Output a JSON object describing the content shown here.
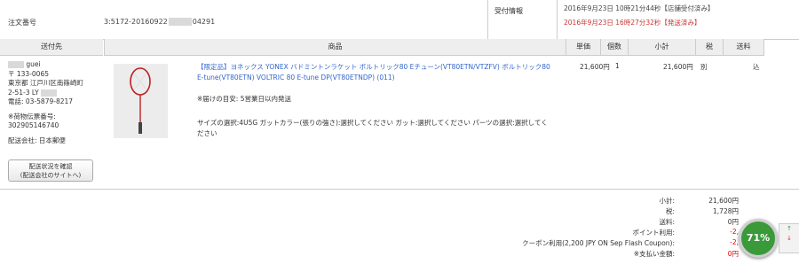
{
  "order": {
    "label": "注文番号",
    "number_prefix": "3:5172-20160922",
    "number_suffix": "04291"
  },
  "info": {
    "label": "受付情報",
    "line1": "2016年9月23日 10時21分44秒【店舗受付済み】",
    "line2": "2016年9月23日 16時27分32秒【発送済み】"
  },
  "headers": {
    "sender": "送付先",
    "product": "商品",
    "unit_price": "単価",
    "qty": "個数",
    "subtotal": "小計",
    "tax": "税",
    "shipping": "送料"
  },
  "sender": {
    "name": "guei",
    "postal": "〒 133-0065",
    "address1": "東京都 江戸川区南篠崎町",
    "address2": "2-51-3 LY",
    "phone": "電話: 03-5879-8217",
    "tracking_label": "※荷物伝票番号:",
    "tracking_no": "302905146740",
    "carrier": "配送会社: 日本郵便",
    "track_button_line1": "配送状況を確認",
    "track_button_line2": "(配送会社のサイトへ)"
  },
  "product": {
    "title": "【限定品】ヨネックス YONEX バドミントンラケット ボルトリック80 Eチューン(VT80ETN/VTZFV) ボルトリック80 E-tune(VT80ETN) VOLTRIC 80 E-tune DP(VT80ETNDP) (011)",
    "ship_note": "※届けの目安: 5営業日以内発送",
    "options": "サイズの選択:4U5G ガットカラー(張りの強さ):選択してください ガット:選択してください パーツの選択:選択してください",
    "unit_price": "21,600円",
    "qty": "1",
    "subtotal": "21,600円",
    "tax": "別",
    "shipping": "込"
  },
  "totals": [
    {
      "label": "小計:",
      "value": "21,600円",
      "red": false
    },
    {
      "label": "税:",
      "value": "1,728円",
      "red": false
    },
    {
      "label": "送料:",
      "value": "0円",
      "red": false
    },
    {
      "label": "ポイント利用:",
      "value": "-2,",
      "red": true
    },
    {
      "label": "クーポン利用(2,200 JPY ON Sep Flash Coupon):",
      "value": "-2,",
      "red": true
    },
    {
      "label": "※支払い金額:",
      "value": "0円",
      "red": true
    }
  ],
  "gauge": {
    "percent_label": "71%",
    "percent": 71,
    "up": "↑",
    "down": "↓"
  }
}
